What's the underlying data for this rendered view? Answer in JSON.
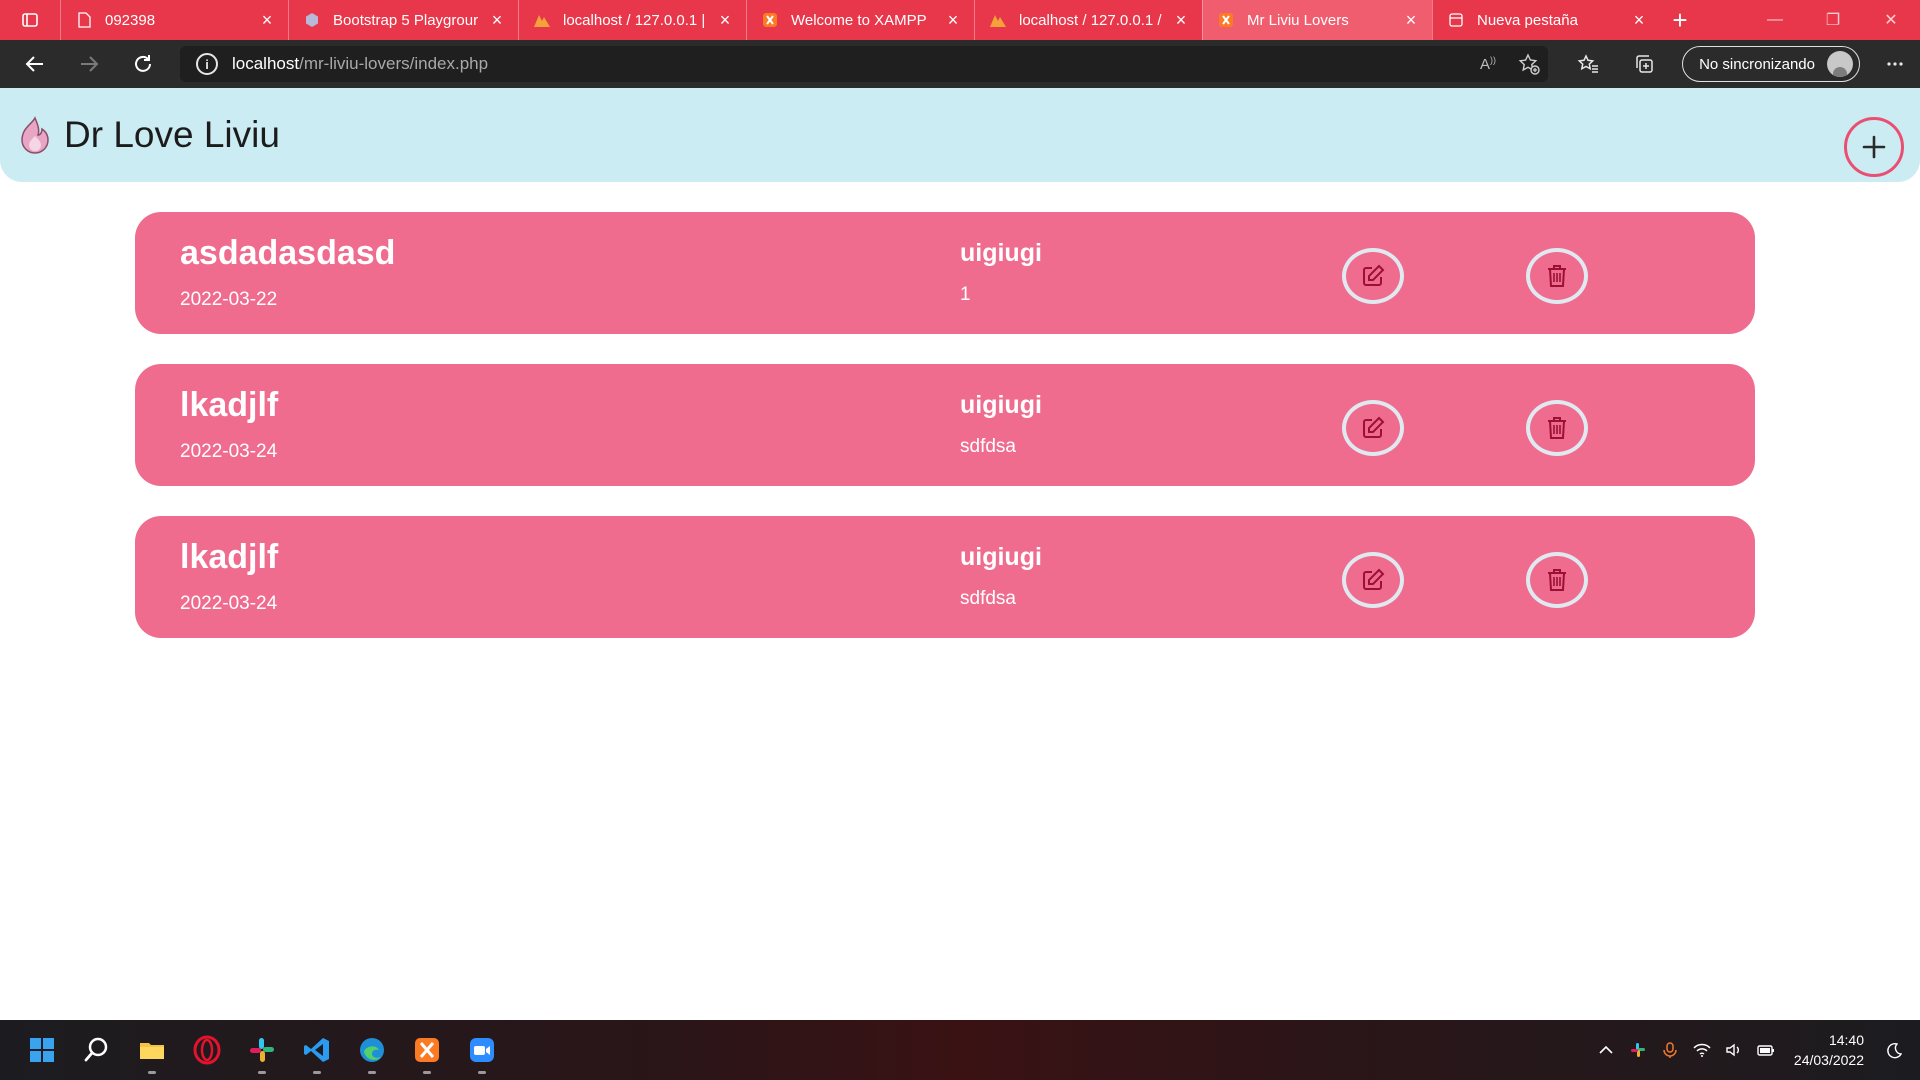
{
  "browser": {
    "tabs": [
      {
        "title": "092398",
        "favicon": "document-icon",
        "active": false,
        "closable": true
      },
      {
        "title": "Bootstrap 5 Playgrour",
        "favicon": "bootstrap-icon",
        "active": false,
        "closable": true
      },
      {
        "title": "localhost / 127.0.0.1 |",
        "favicon": "phpmyadmin-icon",
        "active": false,
        "closable": true
      },
      {
        "title": "Welcome to XAMPP",
        "favicon": "xampp-icon",
        "active": false,
        "closable": true
      },
      {
        "title": "localhost / 127.0.0.1 /",
        "favicon": "phpmyadmin-icon",
        "active": false,
        "closable": true
      },
      {
        "title": "Mr Liviu Lovers",
        "favicon": "xampp-icon",
        "active": true,
        "closable": true
      },
      {
        "title": "Nueva pestaña",
        "favicon": "newtab-icon",
        "active": false,
        "closable": true
      }
    ],
    "url_host": "localhost",
    "url_path": "/mr-liviu-lovers/index.php",
    "profile_label": "No sincronizando",
    "accent_color": "#e8364a"
  },
  "app": {
    "title": "Dr Love Liviu",
    "header_color": "#cbecf2",
    "card_color": "#f06c8f"
  },
  "entries": [
    {
      "title": "asdadasdasd",
      "date": "2022-03-22",
      "user": "uigiugi",
      "detail": "1"
    },
    {
      "title": "lkadjlf",
      "date": "2022-03-24",
      "user": "uigiugi",
      "detail": "sdfdsa"
    },
    {
      "title": "lkadjlf",
      "date": "2022-03-24",
      "user": "uigiugi",
      "detail": "sdfdsa"
    }
  ],
  "taskbar": {
    "apps": [
      "windows-start-icon",
      "search-icon",
      "file-explorer-icon",
      "opera-icon",
      "slack-icon",
      "vscode-icon",
      "edge-icon",
      "xampp-icon",
      "zoom-icon"
    ],
    "time": "14:40",
    "date": "24/03/2022"
  }
}
